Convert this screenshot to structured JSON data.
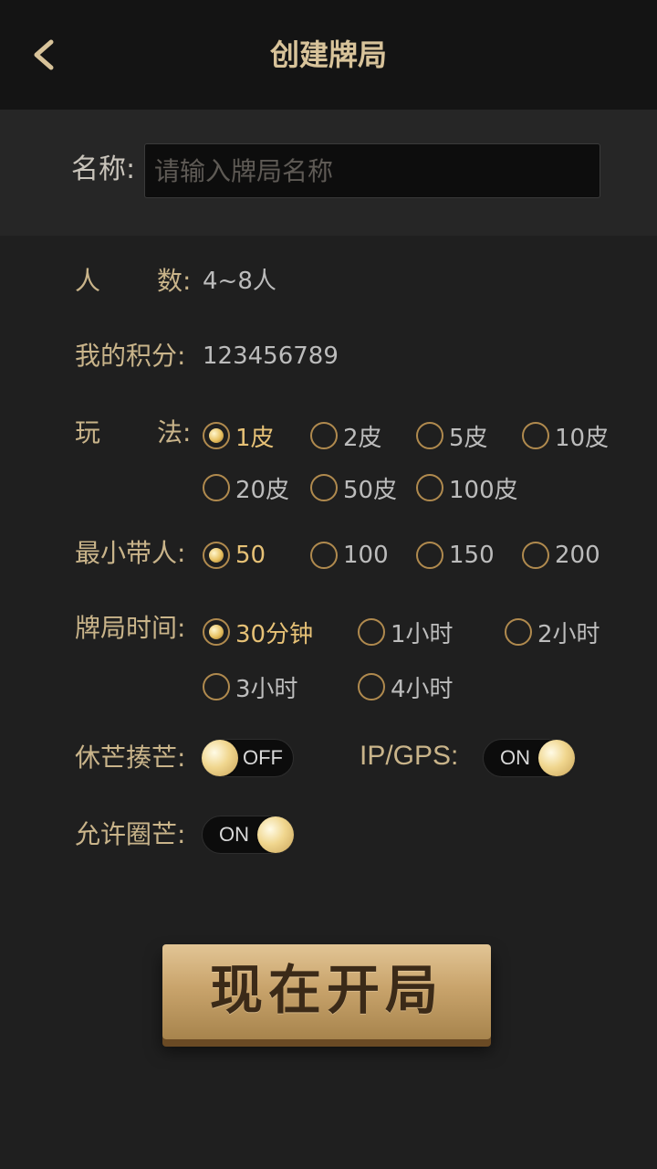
{
  "header": {
    "title": "创建牌局"
  },
  "name": {
    "label": "名称:",
    "placeholder": "请输入牌局名称",
    "value": ""
  },
  "players": {
    "label_a": "人",
    "label_b": "数:",
    "value": "4~8人"
  },
  "score": {
    "label": "我的积分:",
    "value": "123456789"
  },
  "play": {
    "label_a": "玩",
    "label_b": "法:",
    "options": [
      "1皮",
      "2皮",
      "5皮",
      "10皮",
      "20皮",
      "50皮",
      "100皮"
    ],
    "selected": "1皮"
  },
  "min_carry": {
    "label": "最小带人:",
    "options": [
      "50",
      "100",
      "150",
      "200"
    ],
    "selected": "50"
  },
  "duration": {
    "label": "牌局时间:",
    "options": [
      "30分钟",
      "1小时",
      "2小时",
      "3小时",
      "4小时"
    ],
    "selected": "30分钟"
  },
  "toggles": {
    "rest": {
      "label": "休芒揍芒:",
      "state": "OFF"
    },
    "ipgps": {
      "label": "IP/GPS:",
      "state": "ON"
    },
    "circle": {
      "label": "允许圈芒:",
      "state": "ON"
    }
  },
  "start_button": "现在开局",
  "colors": {
    "accent": "#c9b48a",
    "background": "#1f1f1f",
    "header": "#141414"
  }
}
